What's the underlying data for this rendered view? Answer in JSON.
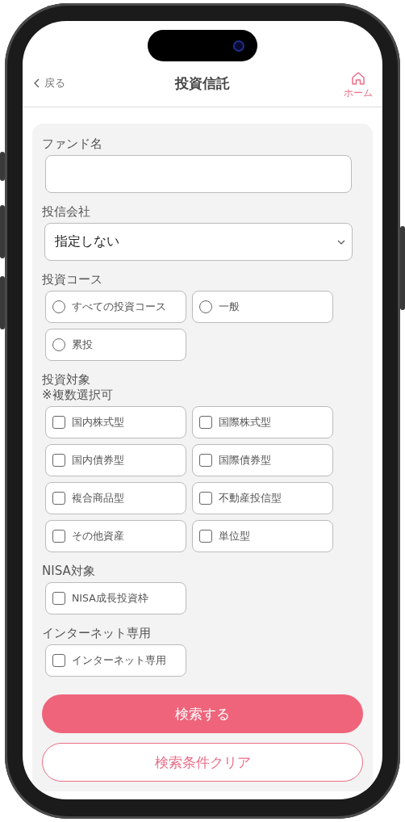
{
  "header": {
    "back_label": "戻る",
    "title": "投資信託",
    "home_label": "ホーム"
  },
  "sections": [
    {
      "kind": "text",
      "label": "ファンド名"
    },
    {
      "kind": "select",
      "label": "投信会社",
      "value": "指定しない"
    },
    {
      "kind": "radio",
      "label": "投資コース",
      "options": [
        {
          "label": "すべての投資コース",
          "selected": false
        },
        {
          "label": "一般",
          "selected": false
        },
        {
          "label": "累投",
          "selected": false
        }
      ]
    },
    {
      "kind": "checkbox",
      "label": "投資対象",
      "note": "※複数選択可",
      "options": [
        {
          "label": "国内株式型",
          "checked": false
        },
        {
          "label": "国際株式型",
          "checked": false
        },
        {
          "label": "国内債券型",
          "checked": false
        },
        {
          "label": "国際債券型",
          "checked": false
        },
        {
          "label": "複合商品型",
          "checked": false
        },
        {
          "label": "不動産投信型",
          "checked": false
        },
        {
          "label": "その他資産",
          "checked": false
        },
        {
          "label": "単位型",
          "checked": false
        }
      ]
    },
    {
      "kind": "checkbox",
      "label": "NISA対象",
      "options": [
        {
          "label": "NISA成長投資枠",
          "checked": false
        }
      ]
    },
    {
      "kind": "checkbox",
      "label": "インターネット専用",
      "options": [
        {
          "label": "インターネット専用",
          "checked": false
        }
      ]
    }
  ],
  "buttons": [
    {
      "kind": "primary",
      "label": "検索する"
    },
    {
      "kind": "outline",
      "label": "検索条件クリア"
    }
  ]
}
